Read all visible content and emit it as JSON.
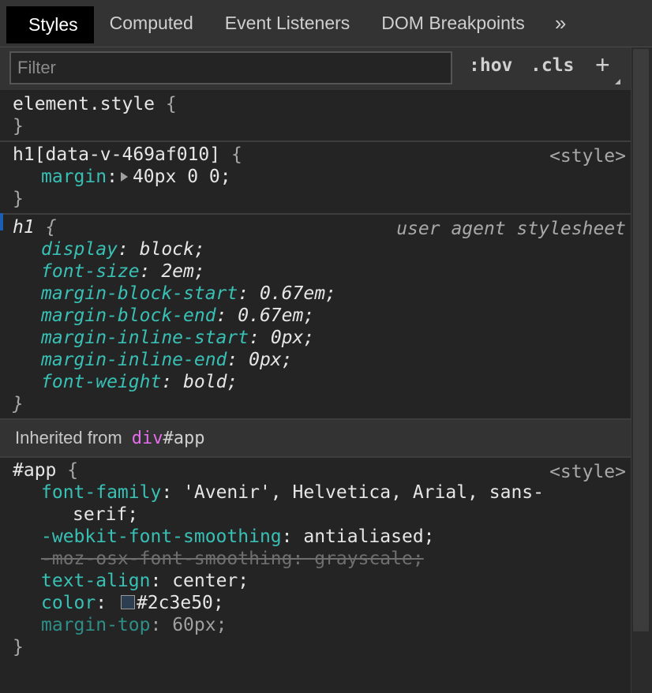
{
  "tabs": [
    {
      "label": "Styles",
      "active": true
    },
    {
      "label": "Computed"
    },
    {
      "label": "Event Listeners"
    },
    {
      "label": "DOM Breakpoints"
    },
    {
      "label": "»"
    }
  ],
  "toolbar": {
    "filter_placeholder": "Filter",
    "hov_label": ":hov",
    "cls_label": ".cls",
    "add_label": "+"
  },
  "rules": {
    "element_style": {
      "selector": "element.style",
      "open": "{",
      "close": "}"
    },
    "h1_scoped": {
      "selector": "h1[data-v-469af010]",
      "open": "{",
      "close": "}",
      "source": "<style>",
      "margin_name": "margin",
      "margin_value": "40px 0 0;"
    },
    "h1_ua": {
      "selector": "h1",
      "open": "{",
      "close": "}",
      "source": "user agent stylesheet",
      "props": [
        {
          "name": "display",
          "value": "block;"
        },
        {
          "name": "font-size",
          "value": "2em;"
        },
        {
          "name": "margin-block-start",
          "value": "0.67em;"
        },
        {
          "name": "margin-block-end",
          "value": "0.67em;"
        },
        {
          "name": "margin-inline-start",
          "value": "0px;"
        },
        {
          "name": "margin-inline-end",
          "value": "0px;"
        },
        {
          "name": "font-weight",
          "value": "bold;"
        }
      ]
    },
    "inherited": {
      "label": "Inherited from",
      "tag": "div",
      "id": "#app"
    },
    "app": {
      "selector": "#app",
      "open": "{",
      "close": "}",
      "source": "<style>",
      "font_family_name": "font-family",
      "font_family_value_1": "'Avenir', Helvetica, Arial, sans-",
      "font_family_value_2": "serif;",
      "webkit_name": "-webkit-font-smoothing",
      "webkit_value": "antialiased;",
      "moz_name": "-moz-osx-font-smoothing",
      "moz_value": "grayscale;",
      "text_align_name": "text-align",
      "text_align_value": "center;",
      "color_name": "color",
      "color_value": "#2c3e50;",
      "color_swatch": "#2c3e50",
      "margin_top_name": "margin-top",
      "margin_top_value": "60px;"
    }
  }
}
